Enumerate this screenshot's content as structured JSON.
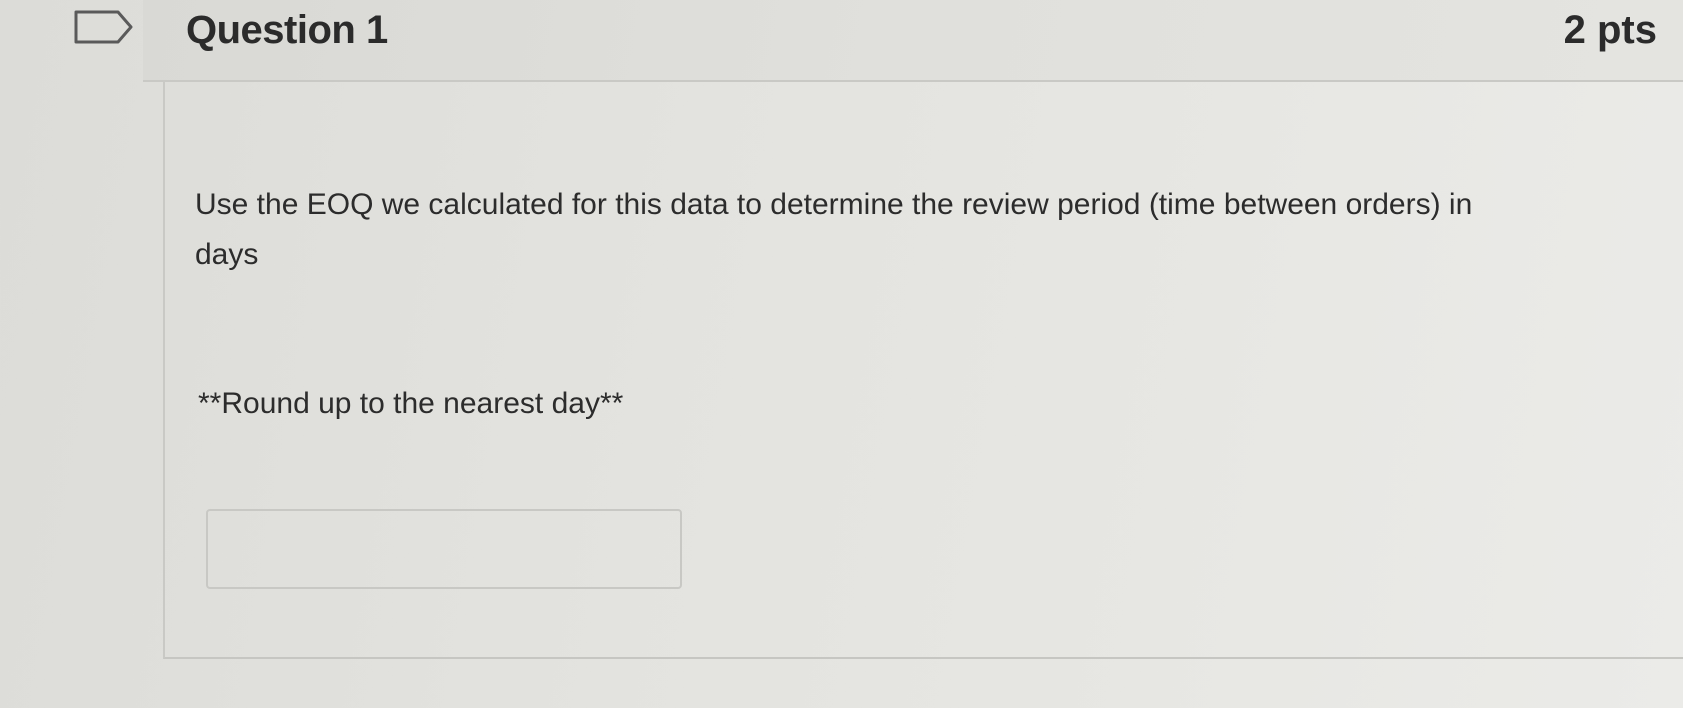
{
  "question": {
    "title": "Question 1",
    "points": "2 pts",
    "text": "Use the EOQ we calculated for this data to determine the review period (time between orders) in days",
    "hint": "**Round up to the nearest day**",
    "answer": {
      "value": "",
      "placeholder": ""
    }
  },
  "icons": {
    "flag": "bookmark-flag-icon"
  },
  "colors": {
    "background": "#e3e3df",
    "border": "#c9c9c5",
    "text": "#2b2b2b"
  }
}
